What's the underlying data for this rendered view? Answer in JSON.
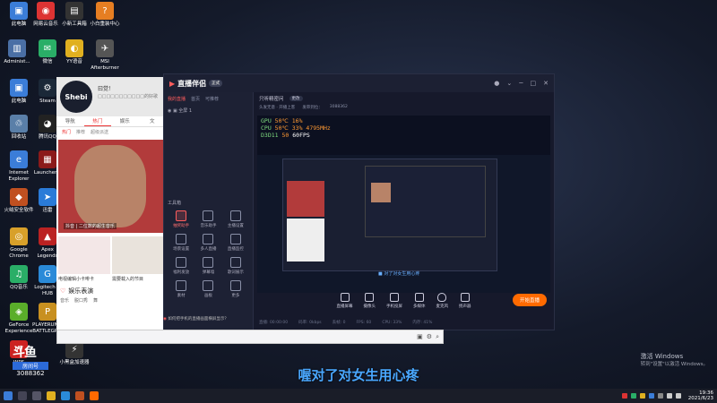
{
  "desktop_icons": [
    {
      "label": "此电脑",
      "color": "#3b7dd8",
      "glyph": "▣"
    },
    {
      "label": "网易云音乐",
      "color": "#d33",
      "glyph": "◉"
    },
    {
      "label": "小新工具箱",
      "color": "#333",
      "glyph": "▤"
    },
    {
      "label": "小白重装中心",
      "color": "#e67e22",
      "glyph": "?"
    },
    {
      "label": "Administ...",
      "color": "#4a6fa5",
      "glyph": "▥"
    },
    {
      "label": "微信",
      "color": "#2aae67",
      "glyph": "✉"
    },
    {
      "label": "YY语音",
      "color": "#e0b020",
      "glyph": "◐"
    },
    {
      "label": "MSI Afterburner",
      "color": "#555",
      "glyph": "✈"
    },
    {
      "label": "此电脑",
      "color": "#3b7dd8",
      "glyph": "▣"
    },
    {
      "label": "Steam",
      "color": "#1b2838",
      "glyph": "⚙"
    },
    {
      "label": "回收站",
      "color": "#5a7fa8",
      "glyph": "♲"
    },
    {
      "label": "腾讯QQ",
      "color": "#222",
      "glyph": "◕"
    },
    {
      "label": "Internet Explorer",
      "color": "#3b7dd8",
      "glyph": "e"
    },
    {
      "label": "Launcher...",
      "color": "#8b1a1a",
      "glyph": "▦"
    },
    {
      "label": "火绒安全软件",
      "color": "#c05020",
      "glyph": "◆"
    },
    {
      "label": "迅雷",
      "color": "#2a7bd8",
      "glyph": "➤"
    },
    {
      "label": "Google Chrome",
      "color": "#d8a02a",
      "glyph": "◎"
    },
    {
      "label": "Apex Legends",
      "color": "#b22",
      "glyph": "▲"
    },
    {
      "label": "QQ音乐",
      "color": "#2aae67",
      "glyph": "♫"
    },
    {
      "label": "Logitech G HUB",
      "color": "#2a8ad8",
      "glyph": "G"
    },
    {
      "label": "GeForce Experience",
      "color": "#5aae2a",
      "glyph": "◈"
    },
    {
      "label": "PLAYERUN... BATTLEGR...",
      "color": "#c89020",
      "glyph": "P"
    },
    {
      "label": "WPS",
      "color": "#c22",
      "glyph": "W"
    },
    {
      "label": "小黑盒加速器",
      "color": "#333",
      "glyph": "⚡"
    }
  ],
  "music_app": {
    "profile_name": "曰觉！",
    "profile_sub": "□□□□□□□□□□□的好歌",
    "avatar_text": "Shebi",
    "tabs": [
      "导航",
      "热门",
      "娱乐",
      "文"
    ],
    "active_tab": 1,
    "subtabs": [
      "热门",
      "推荐",
      "超级派送"
    ],
    "hero_caption": "抖音 | 二位数的超生音乐",
    "thumbs": [
      {
        "title": "电视编辑小卡啡卡"
      },
      {
        "title": "需要载入的节目"
      }
    ],
    "section_title": "娱乐表演",
    "section_tags": [
      "音乐",
      "脱口秀",
      "舞"
    ]
  },
  "stream_app": {
    "title": "直播伴侣",
    "version_badge": "正式",
    "top_right_icons": [
      "avatar",
      "chevron-down-icon",
      "minimize-icon",
      "maximize-icon",
      "close-icon"
    ],
    "left_tabs": [
      "我的直播",
      "首页",
      "可推荐"
    ],
    "scene_label": "◉ ▣  全屏 1",
    "tools_title": "工具箱",
    "tools": [
      {
        "label": "抽奖助手",
        "hot": true
      },
      {
        "label": "音乐助手",
        "hot": false
      },
      {
        "label": "主播设置",
        "hot": false
      },
      {
        "label": "场景设置",
        "hot": false
      },
      {
        "label": "多人直播",
        "hot": false
      },
      {
        "label": "直播监控",
        "hot": false
      },
      {
        "label": "福利发放",
        "hot": false
      },
      {
        "label": "弹幕墙",
        "hot": false
      },
      {
        "label": "歌词展示",
        "hot": false
      },
      {
        "label": "素材",
        "hot": false
      },
      {
        "label": "画板",
        "hot": false
      },
      {
        "label": "更多",
        "hot": false
      }
    ],
    "main_title": "只听精密问",
    "main_pill": "更改",
    "info": [
      "头发无意 · 开播上客",
      "发审到位：",
      "3088362"
    ],
    "osd": {
      "gpu_label": "GPU",
      "gpu_temp": "50",
      "gpu_val": "16",
      "cpu_label": "CPU",
      "cpu_temp": "50",
      "cpu_val": "33",
      "cpu_mhz": "4795",
      "ram_label": "D3D11",
      "ram_temp": "50",
      "fps": "60"
    },
    "inner_caption": "■ 对了对女生用心疼",
    "controls": [
      {
        "label": "直播屏幕",
        "name": "screen-share-button"
      },
      {
        "label": "摄像头",
        "name": "camera-button"
      },
      {
        "label": "手机投屏",
        "name": "phone-cast-button"
      },
      {
        "label": "多媒体",
        "name": "media-button"
      },
      {
        "label": "麦克风",
        "name": "microphone-button"
      },
      {
        "label": "扬声器",
        "name": "speaker-button"
      }
    ],
    "start_live_label": "开始直播",
    "status_items": [
      "直播: 00:00:00",
      "码率: 0kbps",
      "丢帧: 0",
      "FPS: 60",
      "CPU: 33%",
      "内存: 41%"
    ]
  },
  "chat_line": "如何把手机的直播画面横屏显示？",
  "streamer": {
    "logo": "斗鱼",
    "label": "房间号",
    "room_id": "3088362"
  },
  "subtitle": "喔对了对女生用心疼",
  "activate_windows": {
    "title": "激活 Windows",
    "sub": "转到\"设置\"以激活 Windows。"
  },
  "clock": {
    "time": "19:36",
    "date": "2021/6/23"
  },
  "colors": {
    "accent_orange": "#ff6a00",
    "accent_red": "#ff5d5d",
    "subtitle_blue": "#4aa8ff"
  }
}
